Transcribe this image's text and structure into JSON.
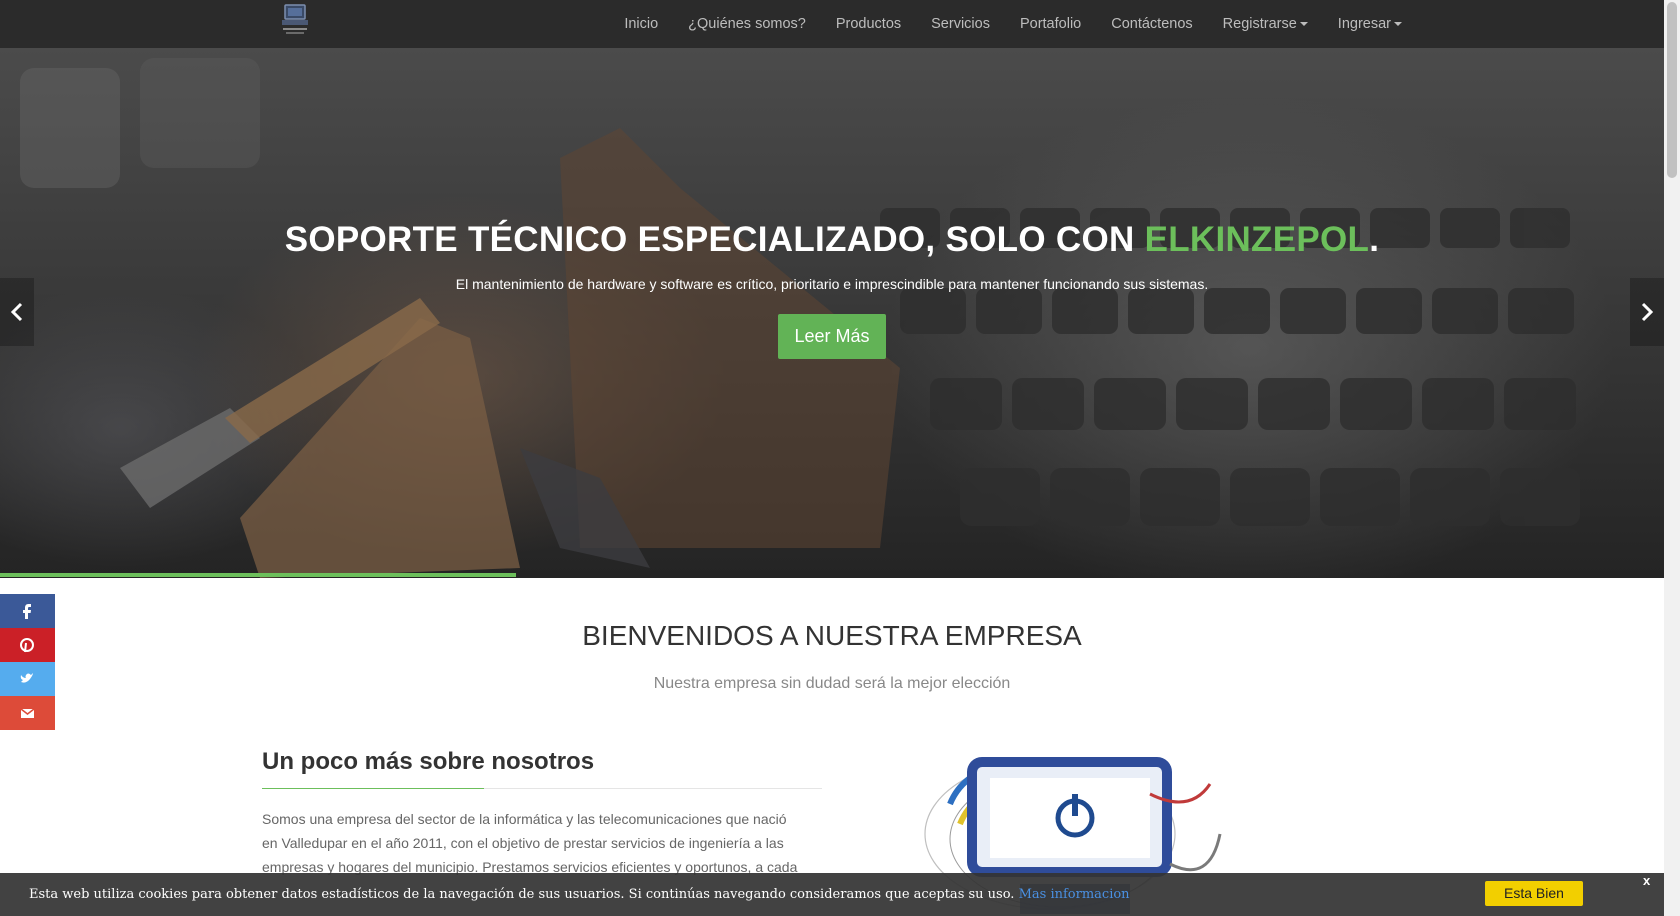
{
  "nav": {
    "logo_alt": "logo",
    "links": [
      {
        "label": "Inicio",
        "dropdown": false
      },
      {
        "label": "¿Quiénes somos?",
        "dropdown": false
      },
      {
        "label": "Productos",
        "dropdown": false
      },
      {
        "label": "Servicios",
        "dropdown": false
      },
      {
        "label": "Portafolio",
        "dropdown": false
      },
      {
        "label": "Contáctenos",
        "dropdown": false
      },
      {
        "label": "Registrarse",
        "dropdown": true
      },
      {
        "label": "Ingresar",
        "dropdown": true
      }
    ]
  },
  "hero": {
    "title_prefix": "SOPORTE TÉCNICO ESPECIALIZADO, SOLO CON ",
    "title_accent": "ELKINZEPOL",
    "title_suffix": ".",
    "subtitle": "El mantenimiento de hardware y software es crítico, prioritario e imprescindible para mantener funcionando sus sistemas.",
    "button": "Leer Más",
    "slide_progress_percent": 31
  },
  "social": [
    {
      "name": "facebook",
      "color": "#3b5998",
      "icon": "f"
    },
    {
      "name": "pinterest",
      "color": "#cb2027",
      "icon": "p"
    },
    {
      "name": "twitter",
      "color": "#55acee",
      "icon": "t"
    },
    {
      "name": "email",
      "color": "#dd4b39",
      "icon": "e"
    }
  ],
  "welcome": {
    "title": "BIENVENIDOS A NUESTRA EMPRESA",
    "subtitle": "Nuestra empresa sin dudad será la mejor elección"
  },
  "about": {
    "title": "Un poco más sobre nosotros",
    "text": "Somos una empresa del sector de la informática y las telecomunicaciones que nació en Valledupar en el año 2011, con el objetivo de prestar servicios de ingeniería a las empresas y hogares del municipio. Prestamos servicios eficientes y oportunos, a cada"
  },
  "cookie": {
    "text": "Esta web utiliza cookies para obtener datos estadísticos de la navegación de sus usuarios. Si continúas navegando consideramos que aceptas su uso.",
    "link": "Mas informacion",
    "button": "Esta Bien",
    "close": "x"
  },
  "colors": {
    "accent": "#6cbf5b",
    "navbar": "#2b2b2b",
    "cookie_button": "#f2cf00"
  }
}
